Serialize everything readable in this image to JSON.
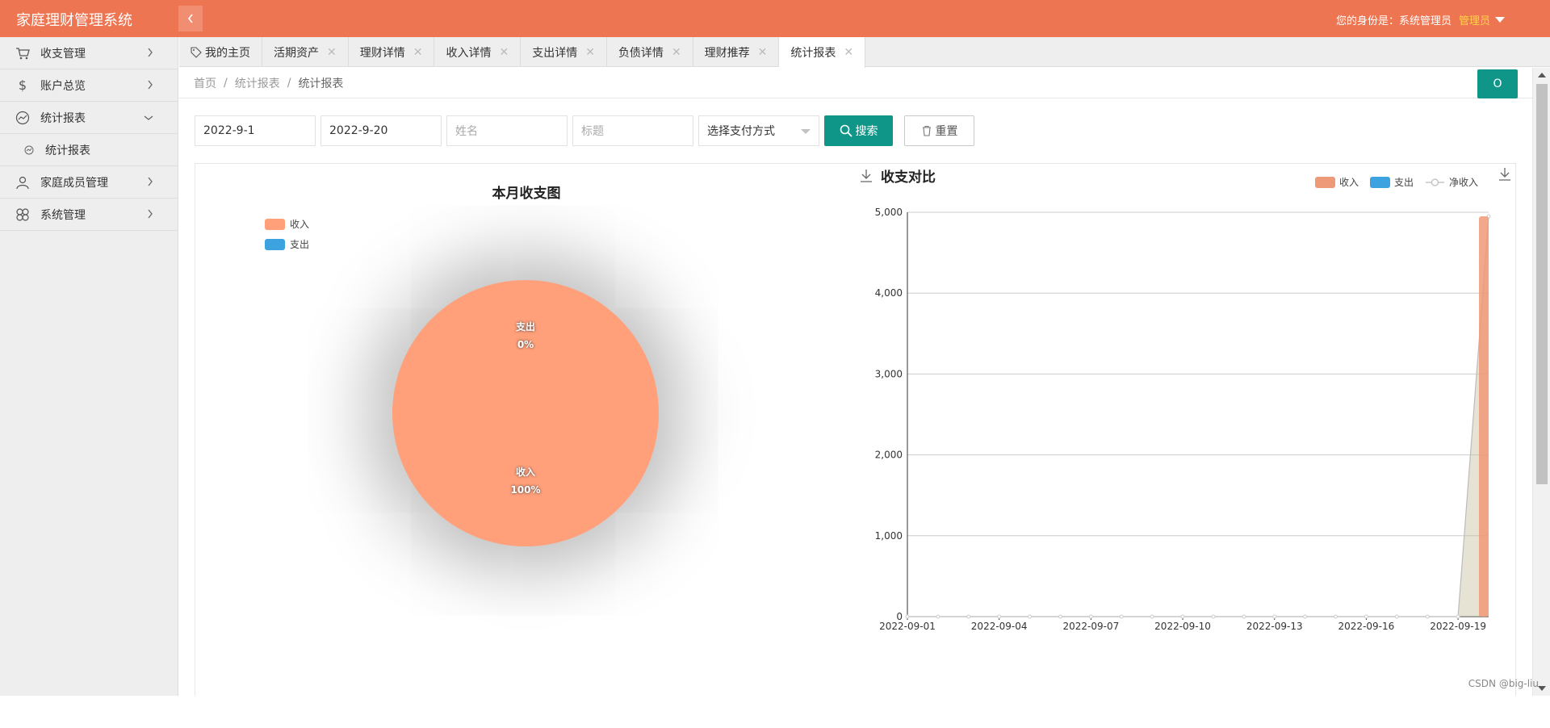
{
  "header": {
    "app_title": "家庭理财管理系统",
    "role_text": "您的身份是：系统管理员",
    "user_name": "管理员"
  },
  "sidebar": {
    "items": [
      {
        "label": "收支管理",
        "icon": "cart-icon"
      },
      {
        "label": "账户总览",
        "icon": "dollar-icon"
      },
      {
        "label": "统计报表",
        "icon": "trend-icon",
        "expanded": true
      },
      {
        "label": "家庭成员管理",
        "icon": "user-icon"
      },
      {
        "label": "系统管理",
        "icon": "flower-icon"
      }
    ],
    "sub_item": "统计报表"
  },
  "tabs": [
    {
      "label": "我的主页",
      "closable": false
    },
    {
      "label": "活期资产",
      "closable": true
    },
    {
      "label": "理财详情",
      "closable": true
    },
    {
      "label": "收入详情",
      "closable": true
    },
    {
      "label": "支出详情",
      "closable": true
    },
    {
      "label": "负债详情",
      "closable": true
    },
    {
      "label": "理财推荐",
      "closable": true
    },
    {
      "label": "统计报表",
      "closable": true,
      "active": true
    }
  ],
  "breadcrumb": {
    "home": "首页",
    "section": "统计报表",
    "current": "统计报表",
    "refresh_label": "O"
  },
  "filter": {
    "start_date": "2022-9-1",
    "end_date": "2022-9-20",
    "name_placeholder": "姓名",
    "title_placeholder": "标题",
    "payment_select": "选择支付方式",
    "search_label": "搜索",
    "reset_label": "重置"
  },
  "colors": {
    "header": "#ee7552",
    "primary": "#0f9688",
    "income": "#ffa07a",
    "expense": "#3ca3e0",
    "net_income": "#cccccc"
  },
  "chart_data": [
    {
      "type": "pie",
      "title": "本月收支图",
      "legend": [
        "收入",
        "支出"
      ],
      "slices": [
        {
          "name": "收入",
          "value_pct": 100,
          "label": "100%"
        },
        {
          "name": "支出",
          "value_pct": 0,
          "label": "0%"
        }
      ]
    },
    {
      "type": "area",
      "title": "收支对比",
      "legend": [
        "收入",
        "支出",
        "净收入"
      ],
      "ylim": [
        0,
        5000
      ],
      "yticks": [
        "0",
        "1,000",
        "2,000",
        "3,000",
        "4,000",
        "5,000"
      ],
      "x": [
        "2022-09-01",
        "2022-09-02",
        "2022-09-03",
        "2022-09-04",
        "2022-09-05",
        "2022-09-06",
        "2022-09-07",
        "2022-09-08",
        "2022-09-09",
        "2022-09-10",
        "2022-09-11",
        "2022-09-12",
        "2022-09-13",
        "2022-09-14",
        "2022-09-15",
        "2022-09-16",
        "2022-09-17",
        "2022-09-18",
        "2022-09-19",
        "2022-09-20"
      ],
      "xtick_labels": [
        "2022-09-01",
        "2022-09-04",
        "2022-09-07",
        "2022-09-10",
        "2022-09-13",
        "2022-09-16",
        "2022-09-19"
      ],
      "series": [
        {
          "name": "收入",
          "type": "bar",
          "values": [
            0,
            0,
            0,
            0,
            0,
            0,
            0,
            0,
            0,
            0,
            0,
            0,
            0,
            0,
            0,
            0,
            0,
            0,
            0,
            4950
          ]
        },
        {
          "name": "支出",
          "type": "bar",
          "values": [
            0,
            0,
            0,
            0,
            0,
            0,
            0,
            0,
            0,
            0,
            0,
            0,
            0,
            0,
            0,
            0,
            0,
            0,
            0,
            0
          ]
        },
        {
          "name": "净收入",
          "type": "area",
          "values": [
            0,
            0,
            0,
            0,
            0,
            0,
            0,
            0,
            0,
            0,
            0,
            0,
            0,
            0,
            0,
            0,
            0,
            0,
            0,
            4950
          ]
        }
      ]
    }
  ],
  "footer": "CSDN @big-liu"
}
